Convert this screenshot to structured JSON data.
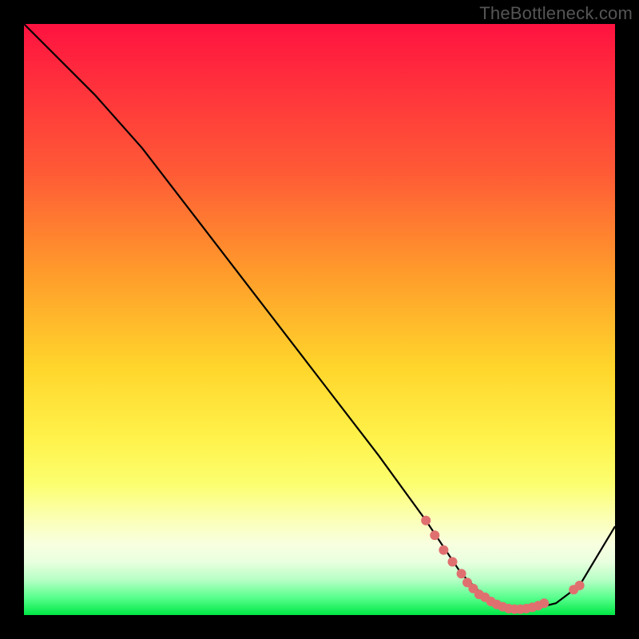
{
  "watermark": "TheBottleneck.com",
  "chart_data": {
    "type": "line",
    "title": "",
    "xlabel": "",
    "ylabel": "",
    "xlim": [
      0,
      100
    ],
    "ylim": [
      0,
      100
    ],
    "grid": false,
    "legend": false,
    "series": [
      {
        "name": "curve",
        "color": "#000000",
        "x": [
          0,
          6,
          12,
          20,
          30,
          40,
          50,
          60,
          68,
          74,
          78,
          82,
          86,
          90,
          94,
          100
        ],
        "y": [
          100,
          94,
          88,
          79,
          66,
          53,
          40,
          27,
          16,
          7,
          3,
          1,
          1,
          2,
          5,
          15
        ]
      }
    ],
    "markers": {
      "name": "highlight-dots",
      "color": "#e07070",
      "x": [
        68,
        69.5,
        71,
        72.5,
        74,
        75,
        76,
        77,
        78,
        79,
        80,
        81,
        82,
        83,
        84,
        85,
        86,
        87,
        88,
        93,
        94
      ],
      "y": [
        16,
        13.5,
        11,
        9,
        7,
        5.5,
        4.5,
        3.5,
        3,
        2.3,
        1.8,
        1.4,
        1.1,
        1,
        1,
        1.1,
        1.3,
        1.6,
        2,
        4.3,
        5
      ]
    },
    "gradient_stops": [
      {
        "pos": 0,
        "color": "#ff1240"
      },
      {
        "pos": 8,
        "color": "#ff2a3d"
      },
      {
        "pos": 25,
        "color": "#ff5a36"
      },
      {
        "pos": 42,
        "color": "#ff9b2b"
      },
      {
        "pos": 58,
        "color": "#ffd52b"
      },
      {
        "pos": 70,
        "color": "#fff24a"
      },
      {
        "pos": 78,
        "color": "#fcff70"
      },
      {
        "pos": 84,
        "color": "#fbffb8"
      },
      {
        "pos": 88,
        "color": "#f8ffe0"
      },
      {
        "pos": 91,
        "color": "#e9ffdf"
      },
      {
        "pos": 94,
        "color": "#b8ffc6"
      },
      {
        "pos": 97,
        "color": "#5aff8e"
      },
      {
        "pos": 100,
        "color": "#00e845"
      }
    ]
  }
}
